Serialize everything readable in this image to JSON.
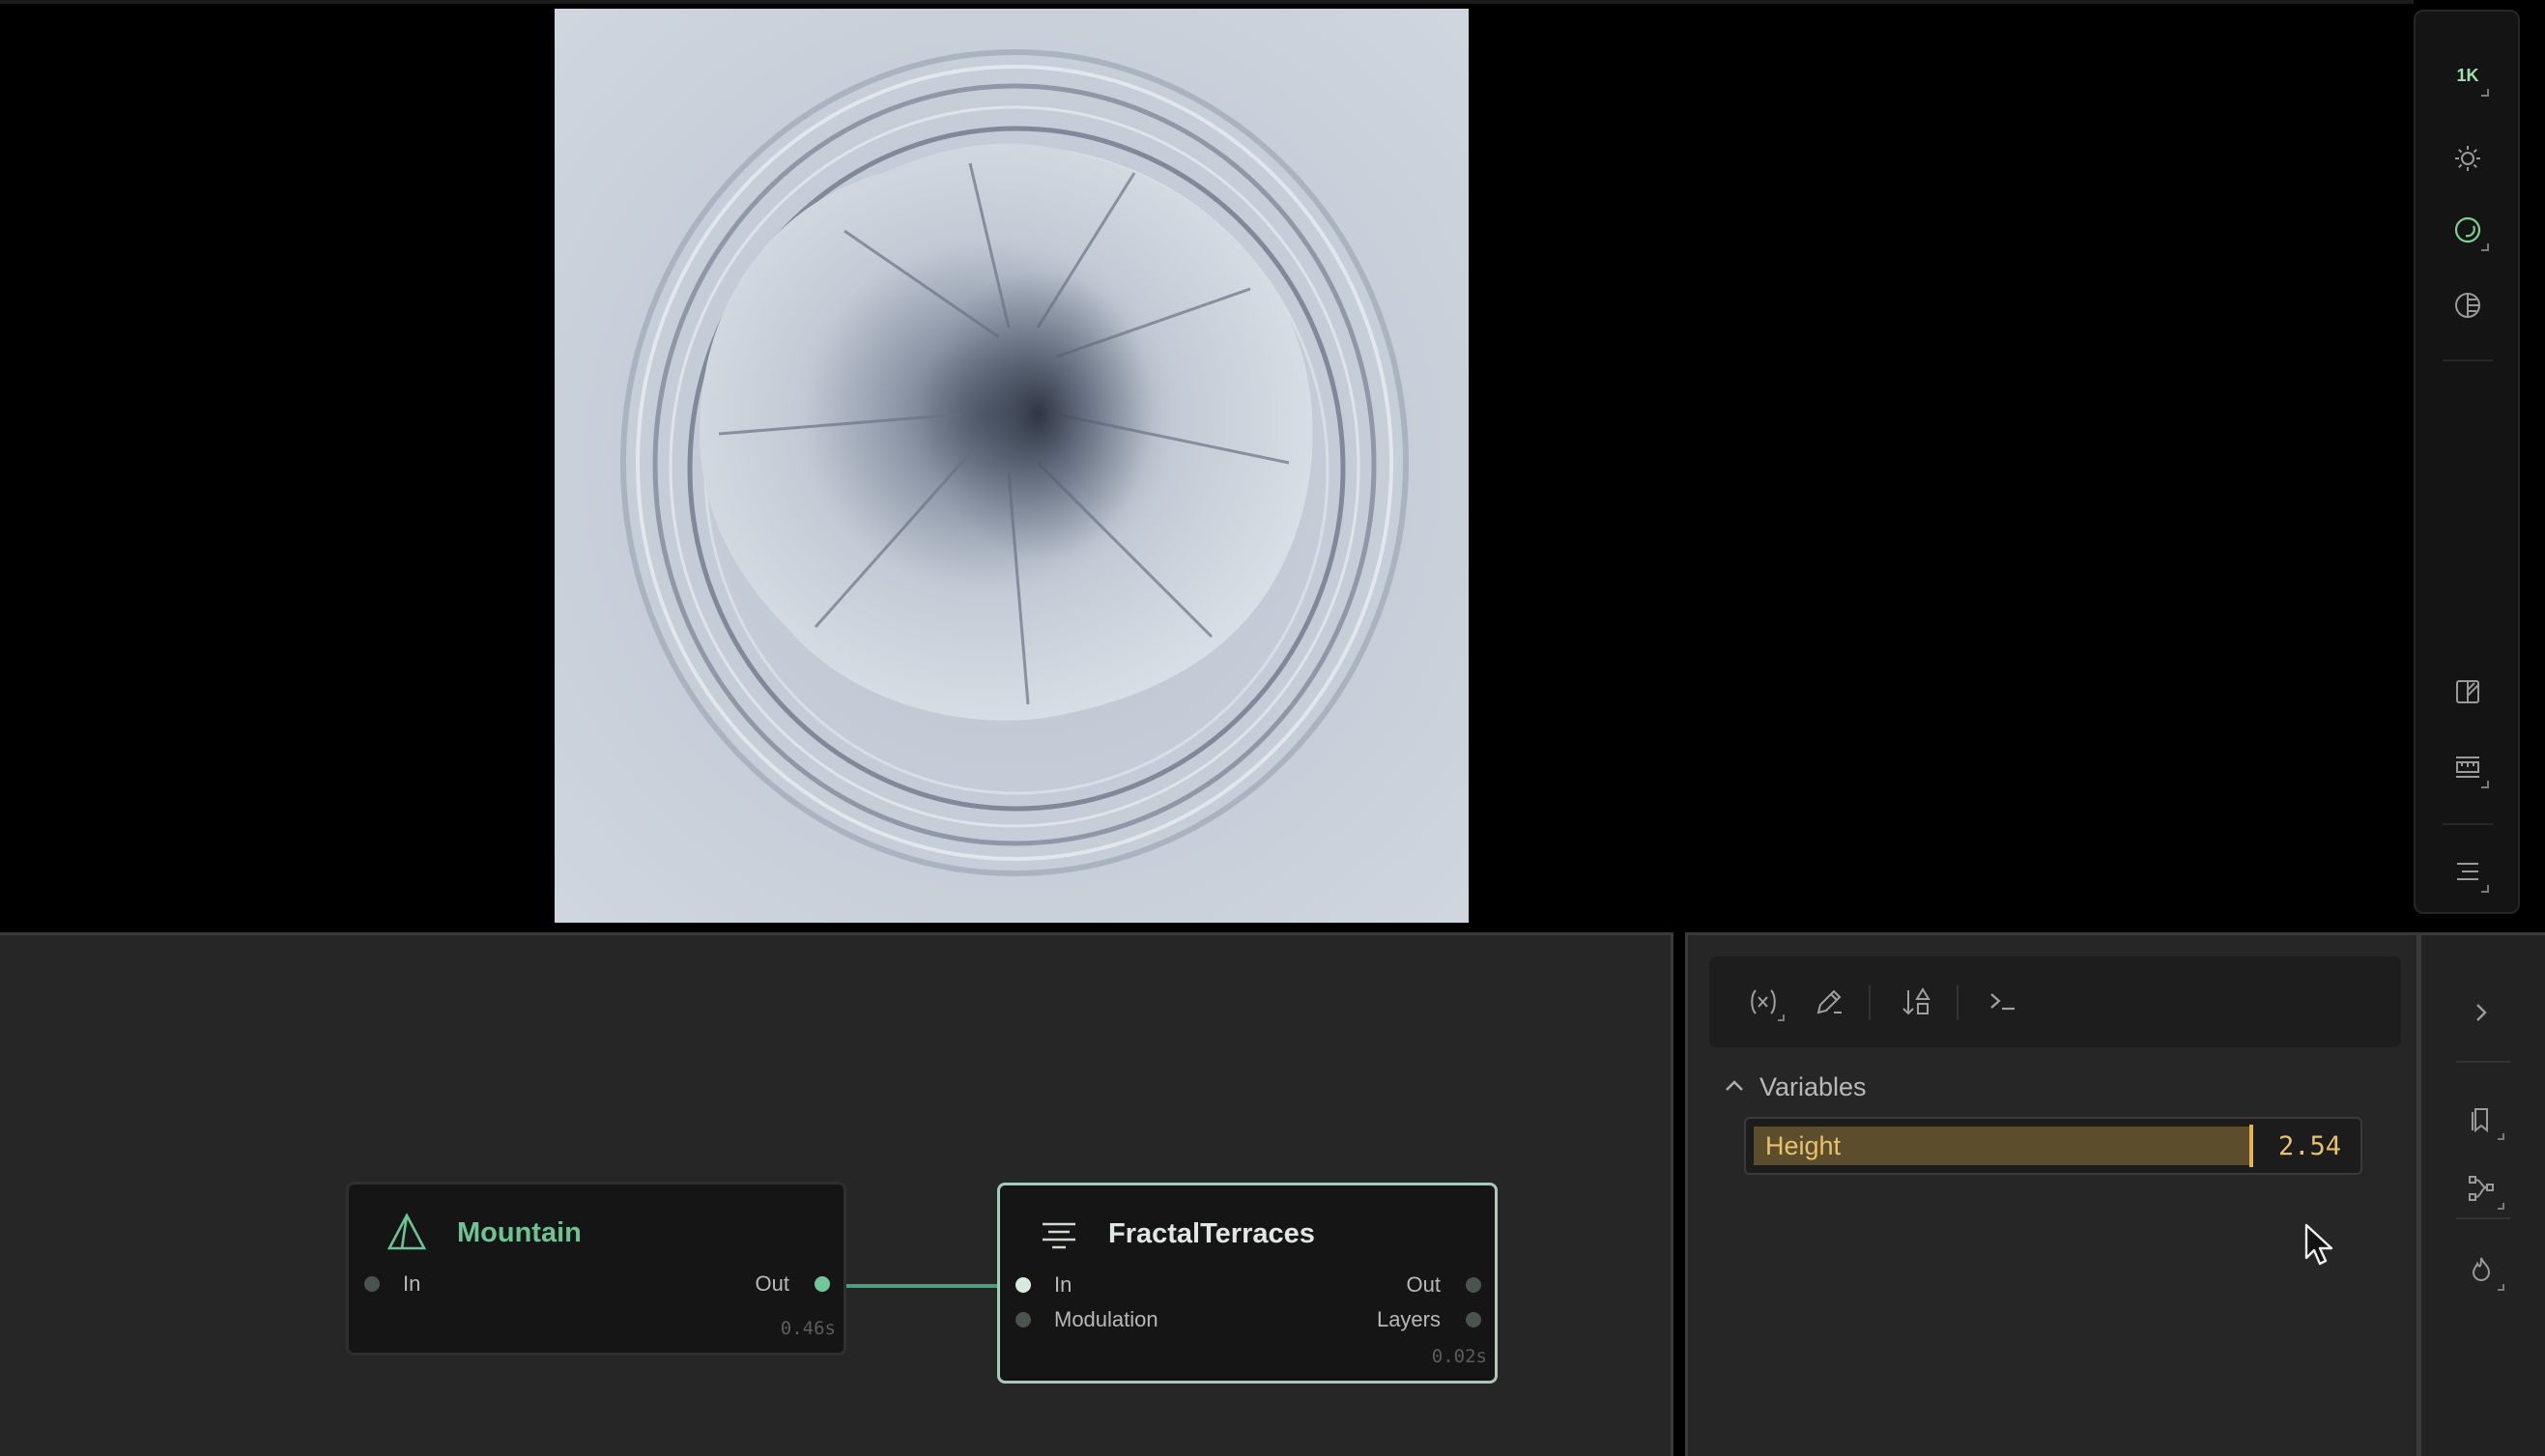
{
  "viewport": {
    "resolution_label": "1K",
    "toolbar_icons": [
      "resolution-icon",
      "sun-icon",
      "shading-icon",
      "contour-icon",
      "split-view-icon",
      "measure-icon",
      "menu-icon"
    ]
  },
  "graph": {
    "nodes": [
      {
        "title": "Mountain",
        "icon": "mountain-icon",
        "inputs": [
          "In"
        ],
        "outputs": [
          "Out"
        ],
        "time": "0.46s"
      },
      {
        "title": "FractalTerraces",
        "icon": "terraces-icon",
        "inputs": [
          "In",
          "Modulation"
        ],
        "outputs": [
          "Out",
          "Layers"
        ],
        "time": "0.02s"
      }
    ]
  },
  "properties": {
    "toolbar_icons": [
      "variable-icon",
      "edit-icon",
      "sort-icon",
      "terminal-icon"
    ],
    "section_title": "Variables",
    "variables": [
      {
        "name": "Height",
        "value": "2.54",
        "fill": 0.83
      }
    ]
  },
  "side_strip_icons": [
    "collapse-chevron-icon",
    "bookmark-icon",
    "graph-icon",
    "fire-icon"
  ],
  "colors": {
    "accent_green": "#6fc79a",
    "variable_gold": "#e3b54a",
    "node_title_green": "#6ec394"
  }
}
